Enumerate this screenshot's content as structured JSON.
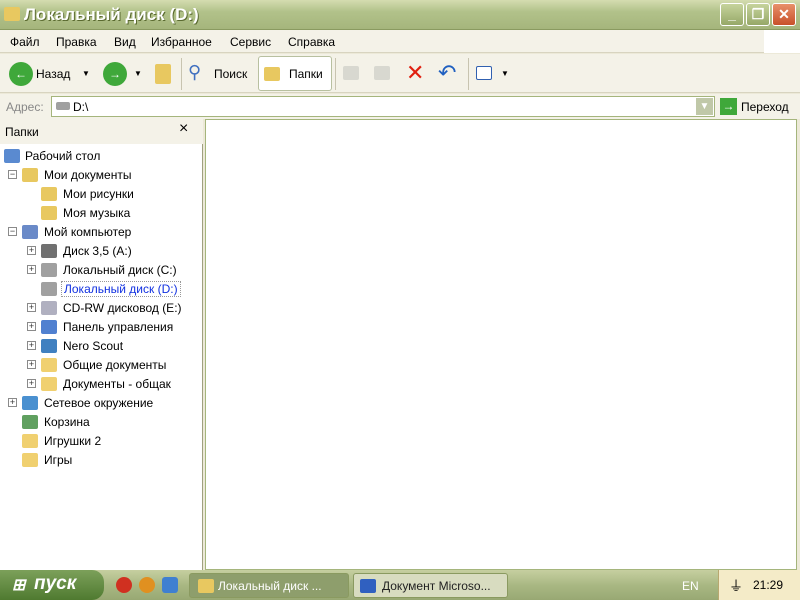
{
  "window": {
    "title": "Локальный диск (D:)"
  },
  "menu": [
    "Файл",
    "Правка",
    "Вид",
    "Избранное",
    "Сервис",
    "Справка"
  ],
  "toolbar": {
    "back": "Назад",
    "search": "Поиск",
    "folders": "Папки"
  },
  "address": {
    "label": "Адрес:",
    "value": "D:\\",
    "go": "Переход"
  },
  "folders_pane": {
    "title": "Папки",
    "close": "×"
  },
  "tree": [
    {
      "label": "Рабочий стол",
      "level": 0,
      "expander": "",
      "icon": "desktop-icon"
    },
    {
      "label": "Мои документы",
      "level": 1,
      "expander": "−",
      "icon": "my-documents-icon"
    },
    {
      "label": "Мои рисунки",
      "level": 2,
      "expander": "",
      "icon": "my-pictures-icon"
    },
    {
      "label": "Моя музыка",
      "level": 2,
      "expander": "",
      "icon": "my-music-icon"
    },
    {
      "label": "Мой компьютер",
      "level": 1,
      "expander": "−",
      "icon": "my-computer-icon"
    },
    {
      "label": "Диск 3,5 (A:)",
      "level": 2,
      "expander": "+",
      "icon": "floppy-icon"
    },
    {
      "label": "Локальный диск (C:)",
      "level": 2,
      "expander": "+",
      "icon": "hard-drive-icon"
    },
    {
      "label": "Локальный диск (D:)",
      "level": 2,
      "expander": "",
      "icon": "hard-drive-icon",
      "selected": true
    },
    {
      "label": "CD-RW дисковод (E:)",
      "level": 2,
      "expander": "+",
      "icon": "cd-drive-icon"
    },
    {
      "label": "Панель управления",
      "level": 2,
      "expander": "+",
      "icon": "control-panel-icon"
    },
    {
      "label": "Nero Scout",
      "level": 2,
      "expander": "+",
      "icon": "nero-scout-icon"
    },
    {
      "label": "Общие документы",
      "level": 2,
      "expander": "+",
      "icon": "folder-icon"
    },
    {
      "label": "Документы - общак",
      "level": 2,
      "expander": "+",
      "icon": "folder-icon"
    },
    {
      "label": "Сетевое окружение",
      "level": 1,
      "expander": "+",
      "icon": "network-icon"
    },
    {
      "label": "Корзина",
      "level": 1,
      "expander": "",
      "icon": "recycle-bin-icon"
    },
    {
      "label": "Игрушки 2",
      "level": 1,
      "expander": "",
      "icon": "folder-icon"
    },
    {
      "label": "Игры",
      "level": 1,
      "expander": "",
      "icon": "folder-icon"
    }
  ],
  "taskbar": {
    "start": "пуск",
    "tasks": [
      "Локальный диск ...",
      "Документ Microso..."
    ],
    "lang": "EN",
    "clock": "21:29"
  }
}
